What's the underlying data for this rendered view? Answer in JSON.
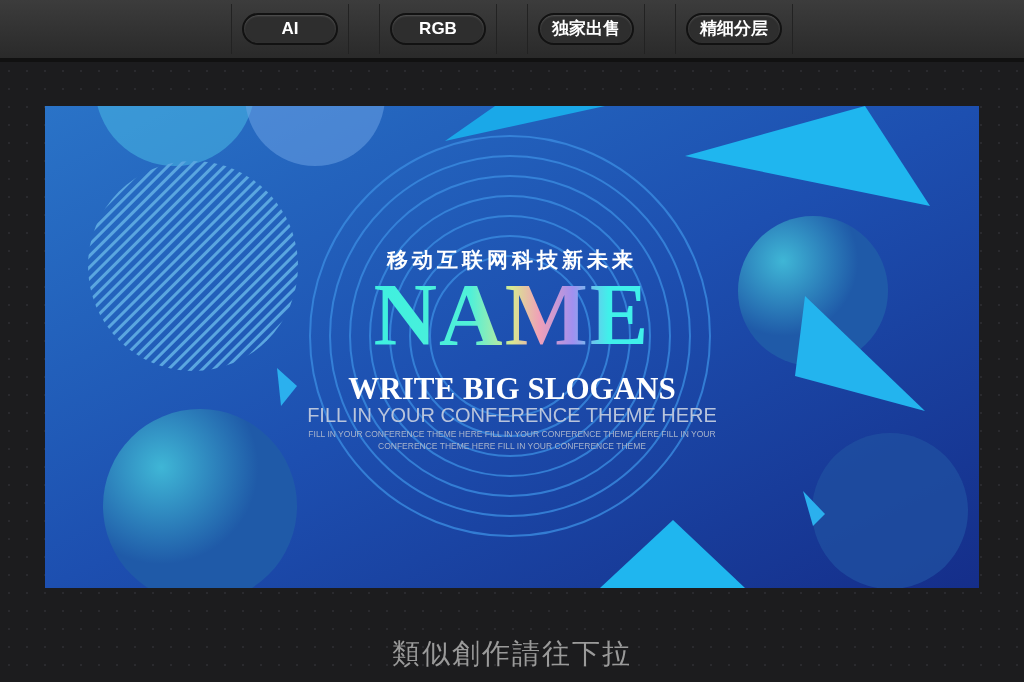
{
  "toolbar": {
    "buttons": [
      {
        "label": "AI"
      },
      {
        "label": "RGB"
      },
      {
        "label": "独家出售"
      },
      {
        "label": "精细分层"
      }
    ]
  },
  "poster": {
    "subtitle": "移动互联网科技新未来",
    "headline": "NAME",
    "slogan": "WRITE BIG SLOGANS",
    "tagline": "FILL IN YOUR CONFERENCE THEME HERE",
    "body": "FILL IN YOUR CONFERENCE THEME HERE FILL IN YOUR CONFERENCE THEME HERE FILL IN YOUR CONFERENCE THEME HERE FILL IN YOUR CONFERENCE THEME"
  },
  "footer": {
    "hint": "類似創作請往下拉"
  }
}
